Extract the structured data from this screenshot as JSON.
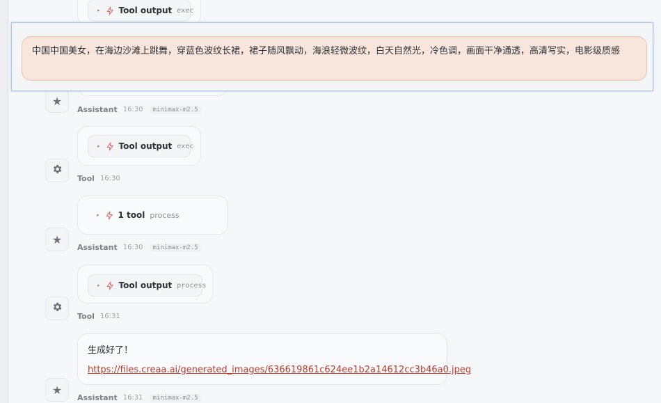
{
  "prompt": {
    "text": "中国中国美女，在海边沙滩上跳舞，穿蓝色波纹长裙，裙子随风飘动，海浪轻微波纹，白天自然光，冷色调，画面干净通透，高清写实，电影级质感"
  },
  "messages": [
    {
      "kind": "tool-output",
      "tool_label": "Tool output",
      "tool_sub": "exec",
      "role": "Tool",
      "time": "16:30"
    },
    {
      "kind": "tool-call",
      "tool_label": "1 tool",
      "tool_sub": "process",
      "role": "Assistant",
      "time": "16:30",
      "model": "minimax-m2.5"
    },
    {
      "kind": "tool-output",
      "tool_label": "Tool output",
      "tool_sub": "process",
      "role": "Tool",
      "time": "16:31"
    },
    {
      "kind": "text",
      "text": "生成好了！",
      "link": "https://files.creaa.ai/generated_images/636619861c624ee1b2a14612cc3b46a0.jpeg",
      "role": "Assistant",
      "time": "16:31",
      "model": "minimax-m2.5"
    }
  ],
  "partial_top": {
    "tool_label": "Tool output",
    "tool_sub": "exec",
    "role": "Assistant",
    "time": "16:30",
    "model": "minimax-m2.5"
  },
  "icons": {
    "assistant_avatar": "star-icon",
    "tool_avatar": "gear-icon",
    "tool": "bolt-icon",
    "expand": "caret-right-icon"
  },
  "colors": {
    "accent_link": "#c0392b",
    "prompt_bg": "#f8e6dc",
    "bolt": "#e06a6a"
  }
}
